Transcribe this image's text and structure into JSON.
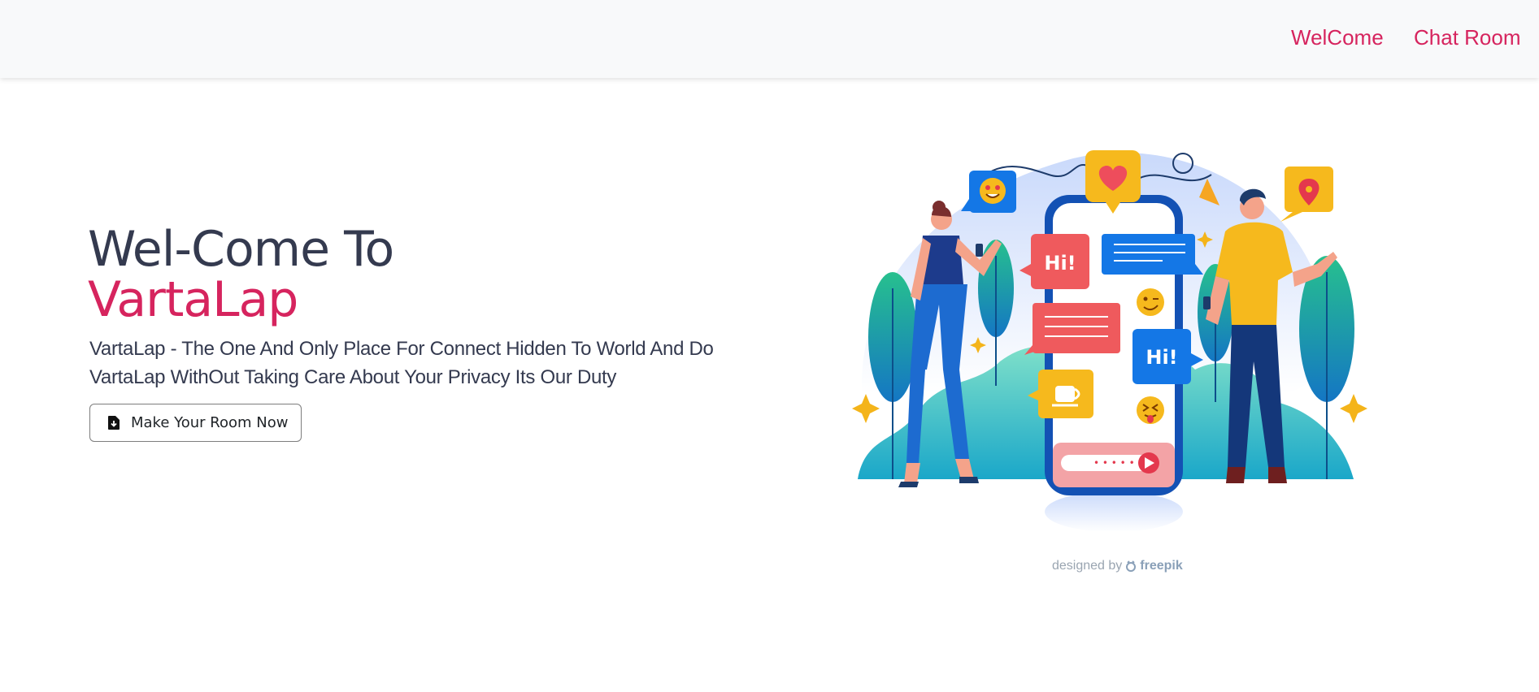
{
  "nav": {
    "welcome_label": "WelCome",
    "chat_label": "Chat Room"
  },
  "hero": {
    "title": "Wel-Come To",
    "brand": "VartaLap",
    "description": "VartaLap - The One And Only Place For Connect Hidden To World And Do VartaLap WithOut Taking Care About Your Privacy Its Our Duty",
    "cta_label": "Make Your Room Now",
    "cta_icon": "file-download-icon"
  },
  "illustration": {
    "bubble_hi_1": "Hi!",
    "bubble_hi_2": "Hi!",
    "credit_prefix": "designed by",
    "credit_brand": "freepik",
    "credit_icon": "freepik-logo-icon"
  },
  "colors": {
    "accent": "#d6245e",
    "text_dark": "#343a4f",
    "navbar_bg": "#f8f9fa"
  }
}
